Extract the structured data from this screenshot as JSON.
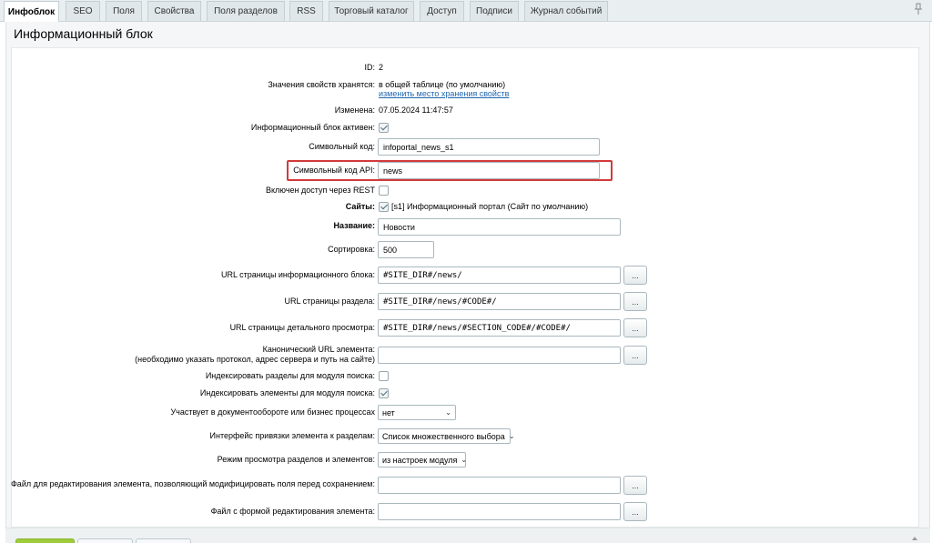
{
  "tabs": [
    {
      "label": "Инфоблок",
      "active": true
    },
    {
      "label": "SEO"
    },
    {
      "label": "Поля"
    },
    {
      "label": "Свойства"
    },
    {
      "label": "Поля разделов"
    },
    {
      "label": "RSS"
    },
    {
      "label": "Торговый каталог"
    },
    {
      "label": "Доступ"
    },
    {
      "label": "Подписи"
    },
    {
      "label": "Журнал событий"
    }
  ],
  "panel_title": "Информационный блок",
  "fields": {
    "id": {
      "label": "ID:",
      "value": "2"
    },
    "storage": {
      "label": "Значения свойств хранятся:",
      "value": "в общей таблице (по умолчанию)",
      "link": "изменить место хранения свойств"
    },
    "modified": {
      "label": "Изменена:",
      "value": "07.05.2024 11:47:57"
    },
    "active": {
      "label": "Информационный блок активен:",
      "checked": true
    },
    "code": {
      "label": "Символьный код:",
      "value": "infoportal_news_s1"
    },
    "api_code": {
      "label": "Символьный код API:",
      "value": "news"
    },
    "rest": {
      "label": "Включен доступ через REST",
      "checked": false
    },
    "sites": {
      "label": "Сайты:",
      "checked": true,
      "value": "[s1] Информационный портал (Сайт по умолчанию)"
    },
    "name": {
      "label": "Название:",
      "value": "Новости"
    },
    "sort": {
      "label": "Сортировка:",
      "value": "500"
    },
    "list_url": {
      "label": "URL страницы информационного блока:",
      "value": "#SITE_DIR#/news/",
      "button": "..."
    },
    "section_url": {
      "label": "URL страницы раздела:",
      "value": "#SITE_DIR#/news/#CODE#/",
      "button": "..."
    },
    "detail_url": {
      "label": "URL страницы детального просмотра:",
      "value": "#SITE_DIR#/news/#SECTION_CODE#/#CODE#/",
      "button": "..."
    },
    "canonical_url": {
      "label_line1": "Канонический URL элемента:",
      "label_line2": "(необходимо указать протокол, адрес сервера и путь на сайте)",
      "value": "",
      "button": "..."
    },
    "index_sections": {
      "label": "Индексировать разделы для модуля поиска:",
      "checked": false
    },
    "index_elements": {
      "label": "Индексировать элементы для модуля поиска:",
      "checked": true
    },
    "workflow": {
      "label": "Участвует в документообороте или бизнес процессах",
      "value": "нет"
    },
    "section_binding": {
      "label": "Интерфейс привязки элемента к разделам:",
      "value": "Список множественного выбора"
    },
    "view_mode": {
      "label": "Режим просмотра разделов и элементов:",
      "value": "из настроек модуля"
    },
    "edit_file": {
      "label": "Файл для редактирования элемента, позволяющий модифицировать поля перед сохранением:",
      "value": "",
      "button": "..."
    },
    "form_file": {
      "label": "Файл с формой редактирования элемента:",
      "value": "",
      "button": "..."
    }
  },
  "colors": {
    "highlight": "#d23a3a",
    "link": "#2067b0",
    "save_button": "#9ecb3a"
  },
  "icons": {
    "pin": "pin-icon",
    "select_arrow": "chevron-down-icon"
  }
}
